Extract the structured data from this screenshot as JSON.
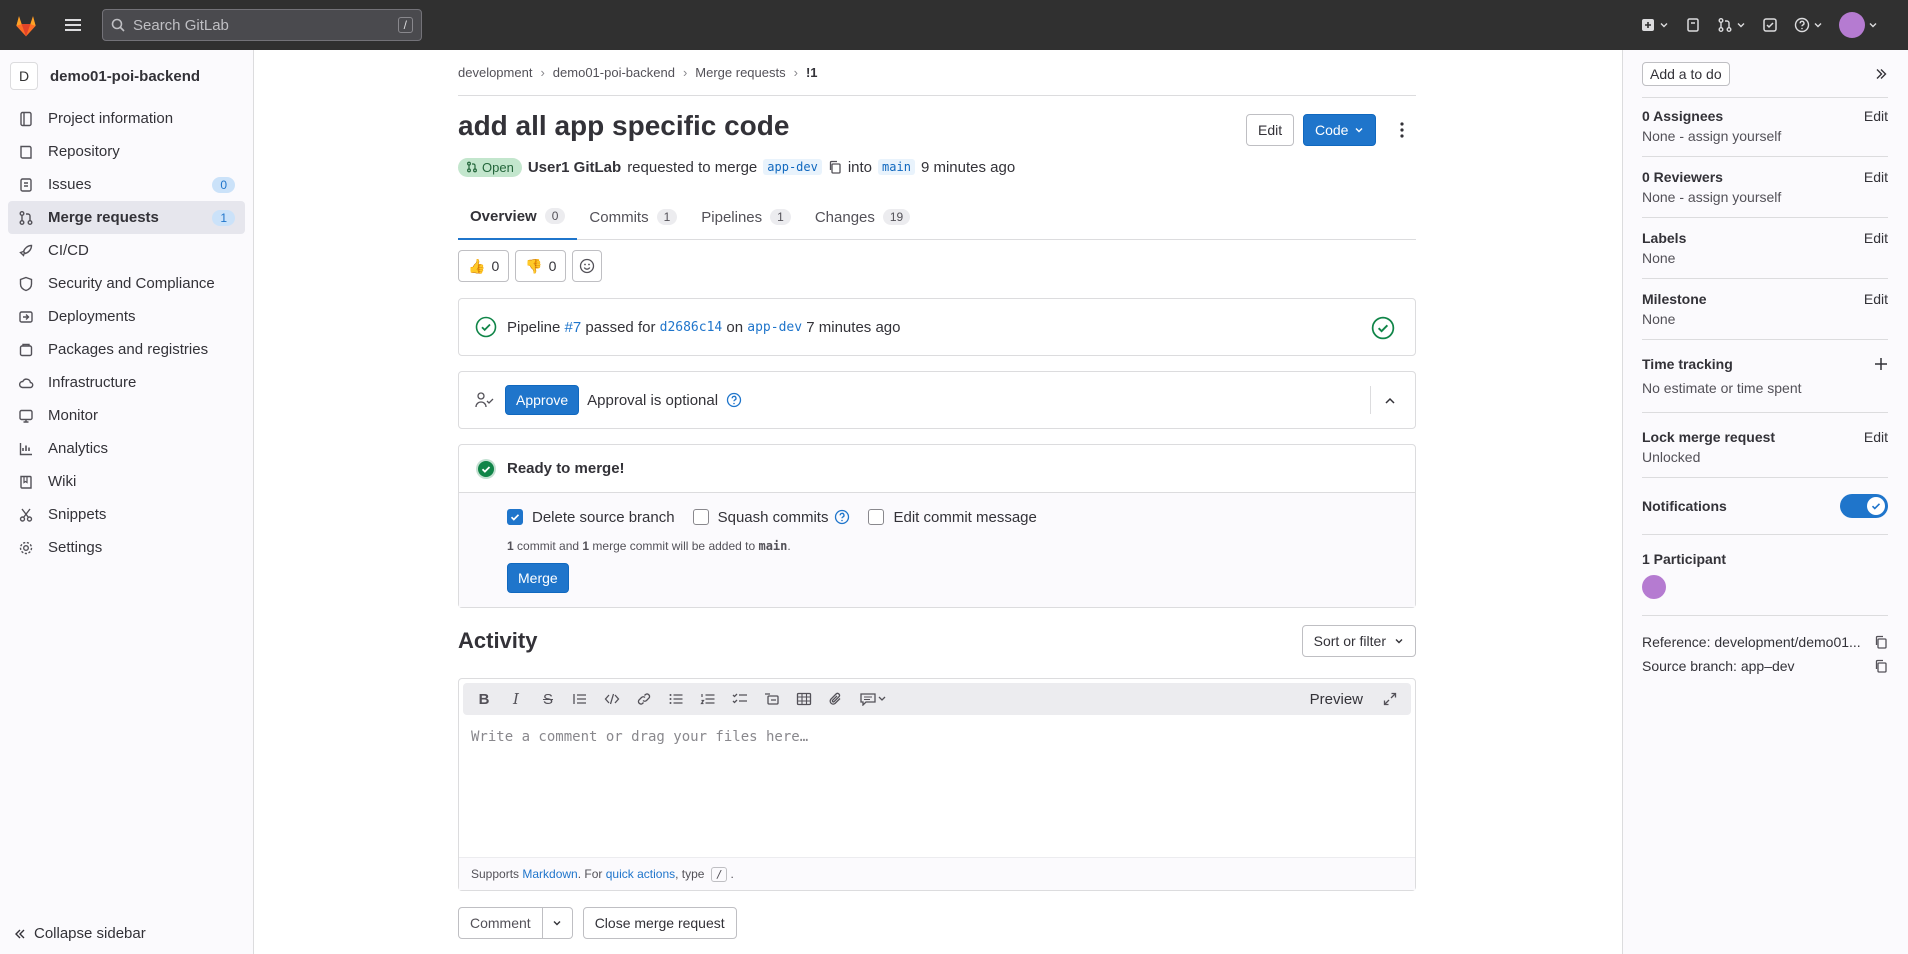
{
  "topbar": {
    "search_placeholder": "Search GitLab",
    "search_shortcut": "/"
  },
  "sidebar": {
    "project_initial": "D",
    "project_name": "demo01-poi-backend",
    "items": [
      {
        "label": "Project information",
        "icon": "project-icon"
      },
      {
        "label": "Repository",
        "icon": "repository-icon"
      },
      {
        "label": "Issues",
        "icon": "issues-icon",
        "count": "0"
      },
      {
        "label": "Merge requests",
        "icon": "merge-request-icon",
        "count": "1",
        "active": true
      },
      {
        "label": "CI/CD",
        "icon": "rocket-icon"
      },
      {
        "label": "Security and Compliance",
        "icon": "shield-icon"
      },
      {
        "label": "Deployments",
        "icon": "deployments-icon"
      },
      {
        "label": "Packages and registries",
        "icon": "package-icon"
      },
      {
        "label": "Infrastructure",
        "icon": "cloud-icon"
      },
      {
        "label": "Monitor",
        "icon": "monitor-icon"
      },
      {
        "label": "Analytics",
        "icon": "chart-icon"
      },
      {
        "label": "Wiki",
        "icon": "book-icon"
      },
      {
        "label": "Snippets",
        "icon": "scissors-icon"
      },
      {
        "label": "Settings",
        "icon": "gear-icon"
      }
    ],
    "collapse_label": "Collapse sidebar"
  },
  "breadcrumb": [
    "development",
    "demo01-poi-backend",
    "Merge requests",
    "!1"
  ],
  "mr": {
    "title": "add all app specific code",
    "edit_label": "Edit",
    "code_label": "Code",
    "status": "Open",
    "author": "User1 GitLab",
    "requested_text": "requested to merge",
    "source_branch": "app-dev",
    "into_text": "into",
    "target_branch": "main",
    "time_ago": "9 minutes ago"
  },
  "tabs": [
    {
      "label": "Overview",
      "count": "0"
    },
    {
      "label": "Commits",
      "count": "1"
    },
    {
      "label": "Pipelines",
      "count": "1"
    },
    {
      "label": "Changes",
      "count": "19"
    }
  ],
  "reactions": {
    "thumbs_up": "0",
    "thumbs_down": "0"
  },
  "pipeline": {
    "prefix": "Pipeline",
    "id": "#7",
    "passed_for": "passed for",
    "commit": "d2686c14",
    "on": "on",
    "branch": "app-dev",
    "time": "7 minutes ago"
  },
  "approval": {
    "button": "Approve",
    "text": "Approval is optional"
  },
  "merge": {
    "title": "Ready to merge!",
    "delete_source": "Delete source branch",
    "squash": "Squash commits",
    "edit_message": "Edit commit message",
    "note_part1": "1",
    "note_part2": " commit and ",
    "note_part3": "1",
    "note_part4": " merge commit will be added to ",
    "note_branch": "main",
    "note_end": ".",
    "button": "Merge"
  },
  "activity": {
    "title": "Activity",
    "sort_label": "Sort or filter"
  },
  "editor": {
    "preview": "Preview",
    "placeholder": "Write a comment or drag your files here…",
    "supports": "Supports ",
    "markdown": "Markdown",
    "for_text": ". For ",
    "quick_actions": "quick actions",
    "type_text": ", type ",
    "slash": "/",
    "period": ".",
    "comment": "Comment",
    "close_mr": "Close merge request"
  },
  "right": {
    "todo": "Add a to do",
    "assignees_title": "0 Assignees",
    "assignees_value": "None - assign yourself",
    "reviewers_title": "0 Reviewers",
    "reviewers_value": "None - assign yourself",
    "labels_title": "Labels",
    "labels_value": "None",
    "milestone_title": "Milestone",
    "milestone_value": "None",
    "time_title": "Time tracking",
    "time_value": "No estimate or time spent",
    "lock_title": "Lock merge request",
    "lock_value": "Unlocked",
    "notifications": "Notifications",
    "participants": "1 Participant",
    "reference": "Reference: development/demo01...",
    "source_branch": "Source branch: app–dev",
    "edit": "Edit"
  },
  "colors": {
    "accent": "#1f75cb",
    "topbar": "#303030",
    "success": "#108548",
    "brand": "#fc6d26"
  }
}
